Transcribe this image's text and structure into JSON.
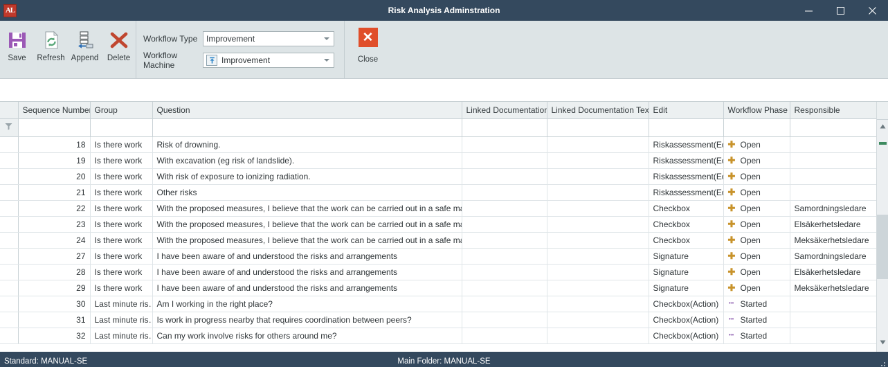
{
  "window": {
    "title": "Risk Analysis Adminstration",
    "logo_text": "AL",
    "logo_icon": "app-logo-icon",
    "minimize_label": "–",
    "maximize_label": "□",
    "close_label": "✕"
  },
  "ribbon": {
    "buttons": [
      {
        "label": "Save",
        "icon": "floppy-disk-icon"
      },
      {
        "label": "Refresh",
        "icon": "refresh-page-icon"
      },
      {
        "label": "Append",
        "icon": "append-rows-icon"
      },
      {
        "label": "Delete",
        "icon": "red-x-delete-icon"
      }
    ],
    "fields": [
      {
        "label": "Workflow Type",
        "value": "Improvement",
        "icon": null
      },
      {
        "label": "Workflow Machine",
        "value": "Improvement",
        "icon": "workflow-machine-icon"
      }
    ],
    "close": {
      "label": "Close",
      "glyph": "✕",
      "icon": "close-window-icon",
      "color": "#e04e2a"
    }
  },
  "grid": {
    "filter_icon": "filter-funnel-icon",
    "columns": [
      "Sequence Number",
      "Group",
      "Question",
      "Linked Documentation",
      "Linked Documentation Text",
      "Edit",
      "Workflow Phase",
      "Responsible"
    ],
    "filter_values": [
      "",
      "",
      "",
      "",
      "",
      "",
      "",
      ""
    ],
    "rows": [
      {
        "seq": "18",
        "group": "Is there work",
        "question": "Risk of drowning.",
        "linked_doc": "",
        "linked_doc_text": "",
        "edit": "Riskassessment(Edit)",
        "phase": "Open",
        "phase_icon": "plus-icon",
        "responsible": ""
      },
      {
        "seq": "19",
        "group": "Is there work",
        "question": "With excavation (eg risk of landslide).",
        "linked_doc": "",
        "linked_doc_text": "",
        "edit": "Riskassessment(Edit)",
        "phase": "Open",
        "phase_icon": "plus-icon",
        "responsible": ""
      },
      {
        "seq": "20",
        "group": "Is there work",
        "question": "With risk of exposure to ionizing radiation.",
        "linked_doc": "",
        "linked_doc_text": "",
        "edit": "Riskassessment(Edit)",
        "phase": "Open",
        "phase_icon": "plus-icon",
        "responsible": ""
      },
      {
        "seq": "21",
        "group": "Is there work",
        "question": "Other risks",
        "linked_doc": "",
        "linked_doc_text": "",
        "edit": "Riskassessment(Edit)",
        "phase": "Open",
        "phase_icon": "plus-icon",
        "responsible": ""
      },
      {
        "seq": "22",
        "group": "Is there work",
        "question": "With the proposed measures, I believe that the work can be carried out in a safe manner.",
        "linked_doc": "",
        "linked_doc_text": "",
        "edit": "Checkbox",
        "phase": "Open",
        "phase_icon": "plus-icon",
        "responsible": "Samordningsledare"
      },
      {
        "seq": "23",
        "group": "Is there work",
        "question": "With the proposed measures, I believe that the work can be carried out in a safe manner.",
        "linked_doc": "",
        "linked_doc_text": "",
        "edit": "Checkbox",
        "phase": "Open",
        "phase_icon": "plus-icon",
        "responsible": "Elsäkerhetsledare"
      },
      {
        "seq": "24",
        "group": "Is there work",
        "question": "With the proposed measures, I believe that the work can be carried out in a safe manner.",
        "linked_doc": "",
        "linked_doc_text": "",
        "edit": "Checkbox",
        "phase": "Open",
        "phase_icon": "plus-icon",
        "responsible": "Meksäkerhetsledare"
      },
      {
        "seq": "27",
        "group": "Is there work",
        "question": "I have been aware of and understood the risks and arrangements",
        "linked_doc": "",
        "linked_doc_text": "",
        "edit": "Signature",
        "phase": "Open",
        "phase_icon": "plus-icon",
        "responsible": "Samordningsledare"
      },
      {
        "seq": "28",
        "group": "Is there work",
        "question": "I have been aware of and understood the risks and arrangements",
        "linked_doc": "",
        "linked_doc_text": "",
        "edit": "Signature",
        "phase": "Open",
        "phase_icon": "plus-icon",
        "responsible": "Elsäkerhetsledare"
      },
      {
        "seq": "29",
        "group": "Is there work",
        "question": "I have been aware of and understood the risks and arrangements",
        "linked_doc": "",
        "linked_doc_text": "",
        "edit": "Signature",
        "phase": "Open",
        "phase_icon": "plus-icon",
        "responsible": "Meksäkerhetsledare"
      },
      {
        "seq": "30",
        "group": "Last minute ris…",
        "question": "Am I working in the right place?",
        "linked_doc": "",
        "linked_doc_text": "",
        "edit": "Checkbox(Action)",
        "phase": "Started",
        "phase_icon": "dots-icon",
        "responsible": ""
      },
      {
        "seq": "31",
        "group": "Last minute ris…",
        "question": "Is work in progress nearby that requires coordination between peers?",
        "linked_doc": "",
        "linked_doc_text": "",
        "edit": "Checkbox(Action)",
        "phase": "Started",
        "phase_icon": "dots-icon",
        "responsible": ""
      },
      {
        "seq": "32",
        "group": "Last minute ris…",
        "question": "Can my work involve risks for others around me?",
        "linked_doc": "",
        "linked_doc_text": "",
        "edit": "Checkbox(Action)",
        "phase": "Started",
        "phase_icon": "dots-icon",
        "responsible": ""
      }
    ],
    "scrollbar": {
      "up_arrow": "▲",
      "down_arrow": "▼",
      "marker_color": "#3d8a5f"
    }
  },
  "statusbar": {
    "left": "Standard: MANUAL-SE",
    "center": "Main Folder: MANUAL-SE",
    "grip_icon": "resize-grip-icon"
  }
}
